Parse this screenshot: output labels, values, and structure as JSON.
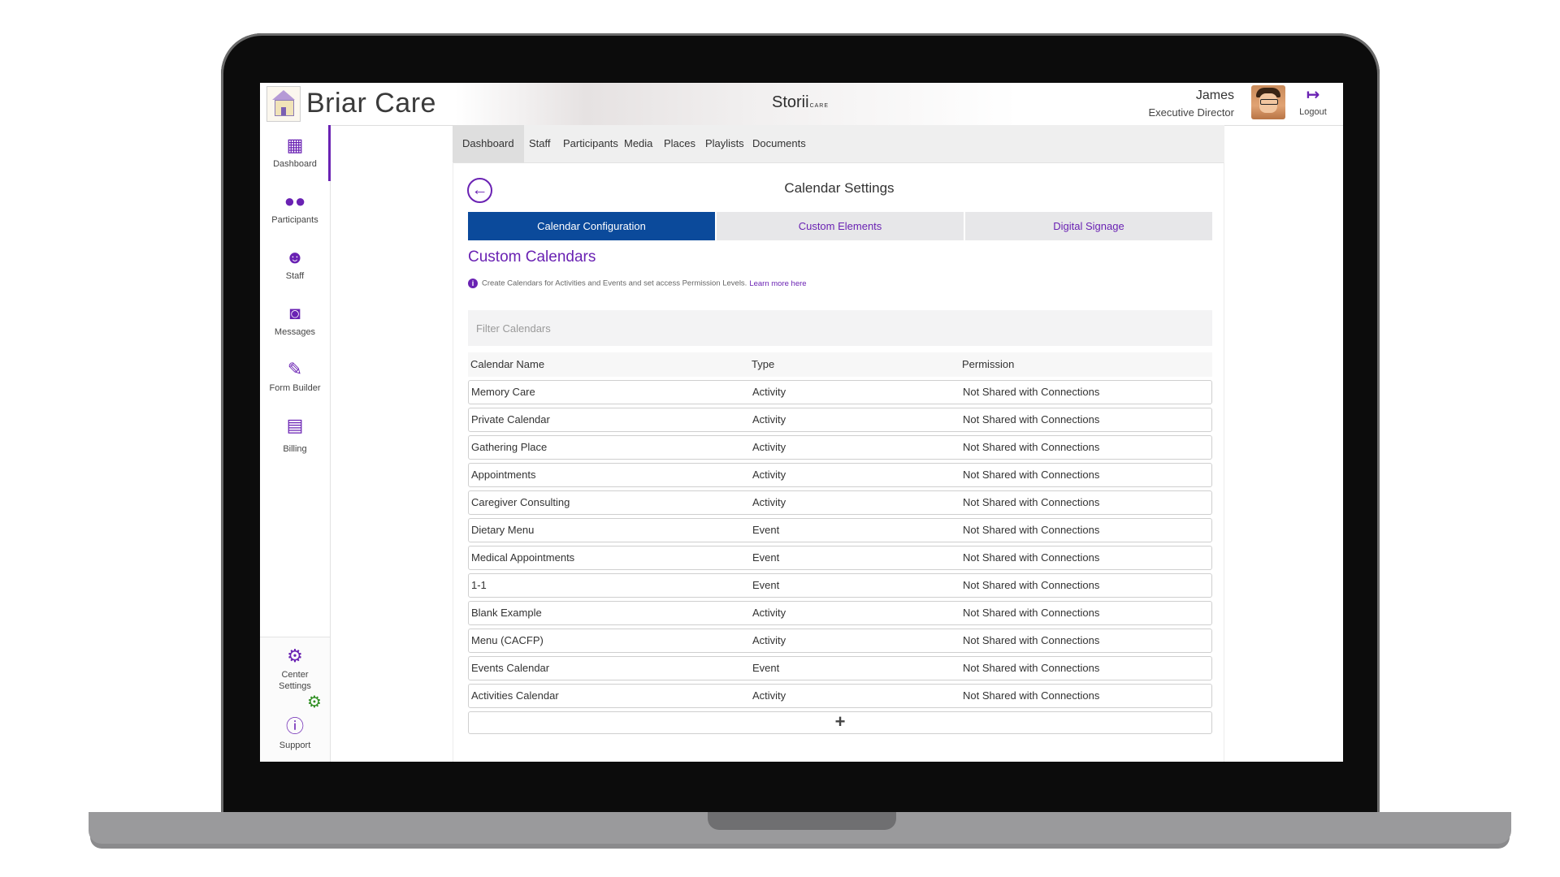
{
  "header": {
    "brand_name": "Briar Care",
    "product_name": "Storii",
    "product_suffix": "CARE",
    "user_name": "James",
    "user_role": "Executive Director",
    "logout_label": "Logout"
  },
  "sidebar": {
    "items": [
      {
        "label": "Dashboard",
        "icon": "dashboard-icon"
      },
      {
        "label": "Participants",
        "icon": "participants-icon"
      },
      {
        "label": "Staff",
        "icon": "staff-icon"
      },
      {
        "label": "Messages",
        "icon": "messages-icon"
      },
      {
        "label": "Form Builder",
        "icon": "form-builder-icon"
      },
      {
        "label": "Billing",
        "icon": "billing-icon"
      }
    ],
    "bottom": [
      {
        "label": "Center Settings",
        "icon": "gear-icon"
      },
      {
        "label": "Support",
        "icon": "help-icon"
      }
    ],
    "accent_color": "#6a22b3"
  },
  "topnav": {
    "items": [
      "Dashboard",
      "Staff",
      "Participants",
      "Media",
      "Places",
      "Playlists",
      "Documents"
    ],
    "active": "Dashboard"
  },
  "page": {
    "title": "Calendar Settings",
    "tabs": [
      "Calendar Configuration",
      "Custom Elements",
      "Digital Signage"
    ],
    "active_tab": "Calendar Configuration",
    "section_title": "Custom Calendars",
    "info_text": "Create Calendars for Activities and Events and set access Permission Levels.",
    "info_link": "Learn more here",
    "filter_placeholder": "Filter Calendars",
    "add_label": "+"
  },
  "table": {
    "columns": [
      "Calendar Name",
      "Type",
      "Permission"
    ],
    "rows": [
      [
        "Memory Care",
        "Activity",
        "Not Shared with Connections"
      ],
      [
        "Private Calendar",
        "Activity",
        "Not Shared with Connections"
      ],
      [
        "Gathering Place",
        "Activity",
        "Not Shared with Connections"
      ],
      [
        "Appointments",
        "Activity",
        "Not Shared with Connections"
      ],
      [
        "Caregiver Consulting",
        "Activity",
        "Not Shared with Connections"
      ],
      [
        "Dietary Menu",
        "Event",
        "Not Shared with Connections"
      ],
      [
        "Medical Appointments",
        "Event",
        "Not Shared with Connections"
      ],
      [
        "1-1",
        "Event",
        "Not Shared with Connections"
      ],
      [
        "Blank Example",
        "Activity",
        "Not Shared with Connections"
      ],
      [
        "Menu (CACFP)",
        "Activity",
        "Not Shared with Connections"
      ],
      [
        "Events Calendar",
        "Event",
        "Not Shared with Connections"
      ],
      [
        "Activities Calendar",
        "Activity",
        "Not Shared with Connections"
      ]
    ]
  },
  "colors": {
    "accent": "#6a22b3",
    "active_tab": "#0b4a9b",
    "support_badge": "#2f8f22"
  }
}
